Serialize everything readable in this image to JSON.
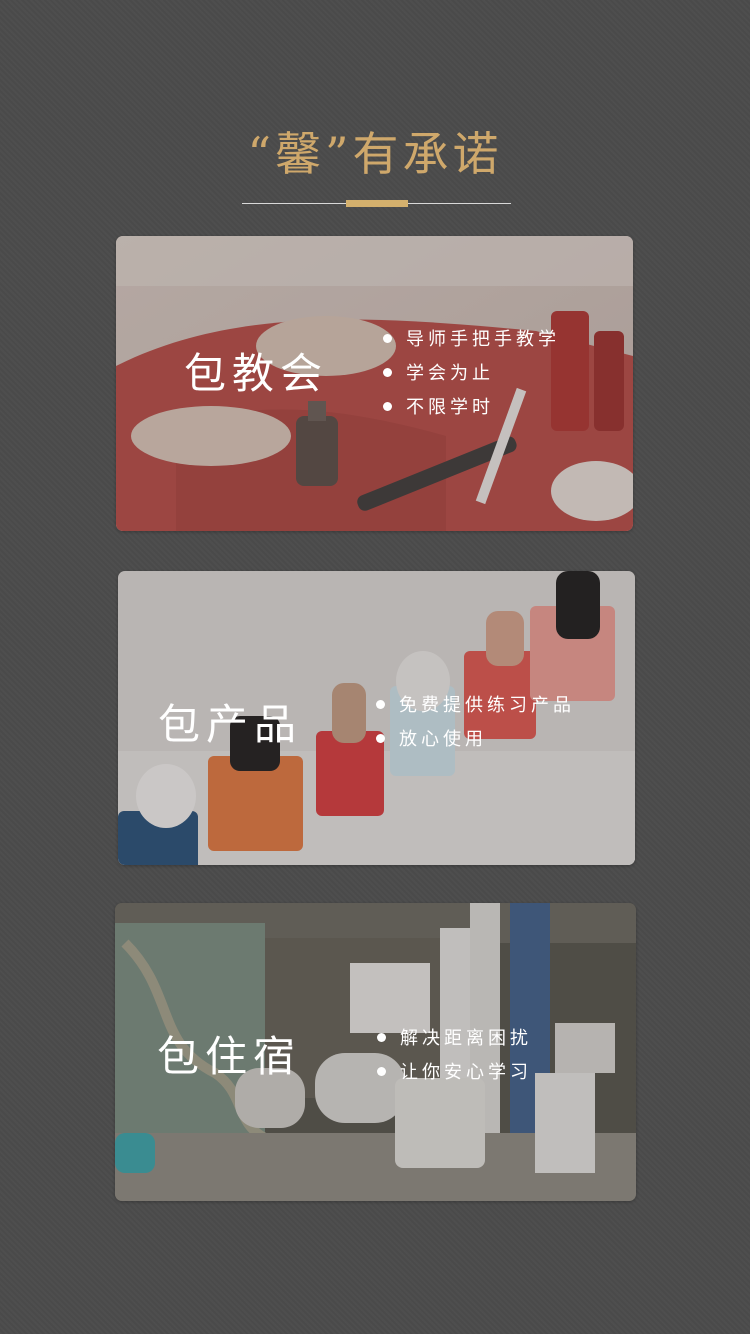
{
  "header": {
    "title": "“馨”有承诺"
  },
  "cards": [
    {
      "title": "包教会",
      "bullets": [
        "导师手把手教学",
        "学会为止",
        "不限学时"
      ]
    },
    {
      "title": "包产品",
      "bullets": [
        "免费提供练习产品",
        "放心使用"
      ]
    },
    {
      "title": "包住宿",
      "bullets": [
        "解决距离困扰",
        "让你安心学习"
      ]
    }
  ],
  "colors": {
    "background": "#4b4b4b",
    "accent_gold": "#cfa86b",
    "text_white": "#ffffff"
  }
}
